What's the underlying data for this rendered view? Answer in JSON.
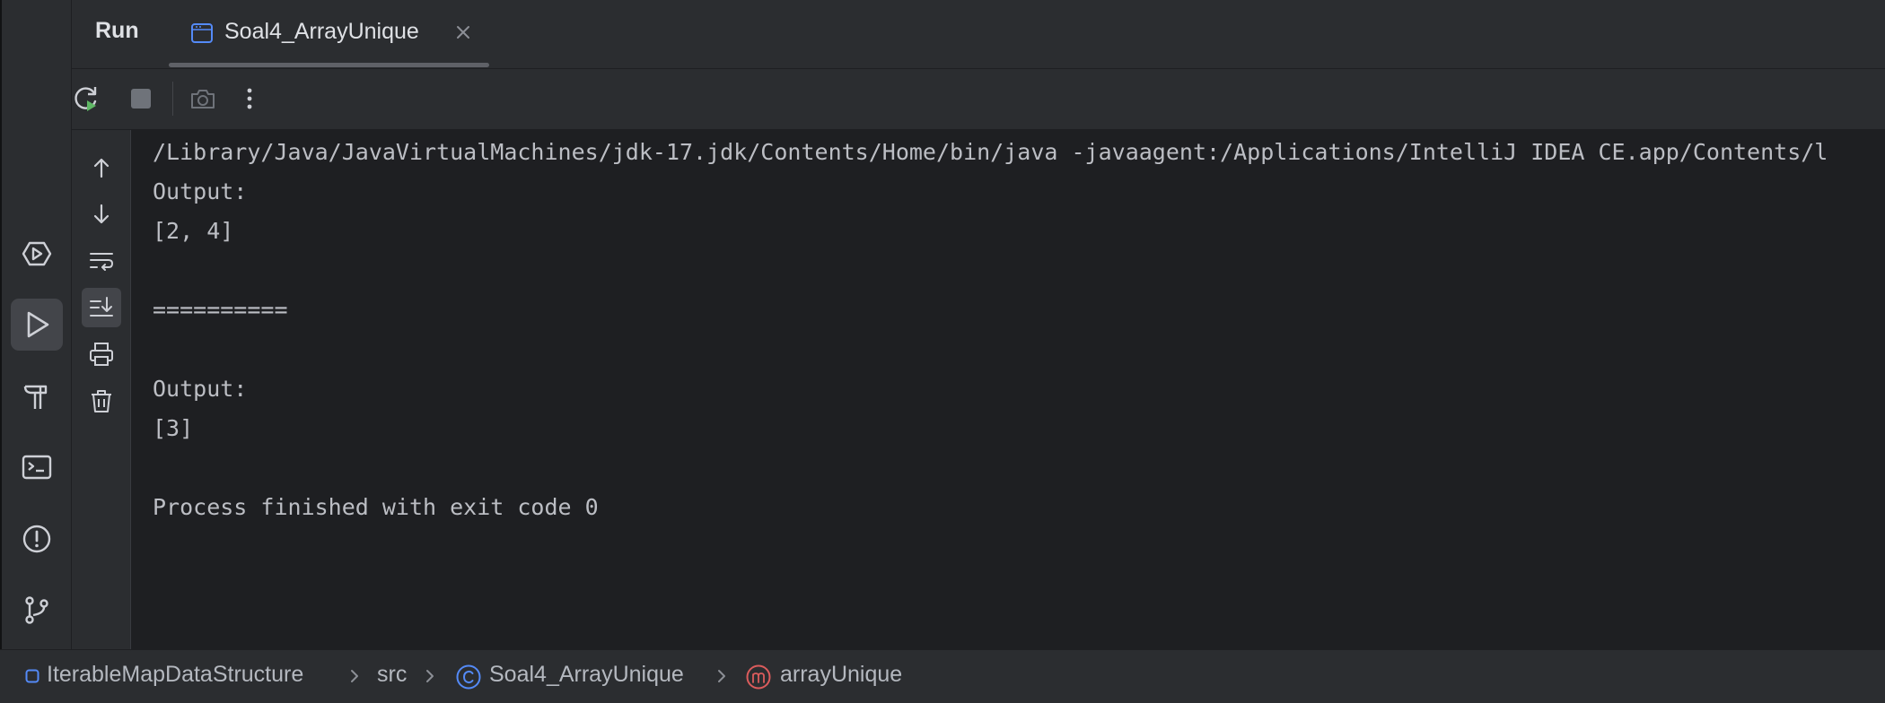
{
  "header": {
    "tool_window_title": "Run",
    "tabs": [
      {
        "label": "Soal4_ArrayUnique",
        "active": true
      }
    ]
  },
  "toolbar": {
    "buttons": [
      {
        "name": "rerun",
        "icon": "rerun-icon"
      },
      {
        "name": "stop",
        "icon": "stop-icon"
      },
      {
        "name": "screenshot",
        "icon": "camera-icon"
      },
      {
        "name": "more",
        "icon": "more-vertical-icon"
      }
    ]
  },
  "left_stripe": {
    "items": [
      {
        "name": "services",
        "icon": "services-icon"
      },
      {
        "name": "run",
        "icon": "run-icon",
        "active": true
      },
      {
        "name": "build",
        "icon": "hammer-icon"
      },
      {
        "name": "terminal",
        "icon": "terminal-icon"
      },
      {
        "name": "problems",
        "icon": "problems-icon"
      },
      {
        "name": "git",
        "icon": "git-branch-icon"
      }
    ]
  },
  "console_tools": {
    "items": [
      {
        "name": "up",
        "icon": "arrow-up-icon"
      },
      {
        "name": "down",
        "icon": "arrow-down-icon"
      },
      {
        "name": "soft-wrap",
        "icon": "soft-wrap-icon"
      },
      {
        "name": "scroll-to-end",
        "icon": "scroll-to-end-icon",
        "active": true
      },
      {
        "name": "print",
        "icon": "print-icon"
      },
      {
        "name": "clear",
        "icon": "trash-icon"
      }
    ]
  },
  "console": {
    "lines": [
      "/Library/Java/JavaVirtualMachines/jdk-17.jdk/Contents/Home/bin/java -javaagent:/Applications/IntelliJ IDEA CE.app/Contents/l",
      "Output:",
      "[2, 4]",
      "",
      "==========",
      "",
      "Output:",
      "[3]",
      "",
      "Process finished with exit code 0"
    ]
  },
  "breadcrumb": {
    "items": [
      {
        "label": "IterableMapDataStructure",
        "icon": "module-icon"
      },
      {
        "label": "src",
        "icon": ""
      },
      {
        "label": "Soal4_ArrayUnique",
        "icon": "class-icon"
      },
      {
        "label": "arrayUnique",
        "icon": "method-icon"
      }
    ]
  },
  "colors": {
    "background": "#1e1f22",
    "panel": "#2b2d30",
    "text": "#bcbec4",
    "class_icon": "#548af7",
    "method_icon": "#db5c5c",
    "run_green": "#5fb865"
  }
}
